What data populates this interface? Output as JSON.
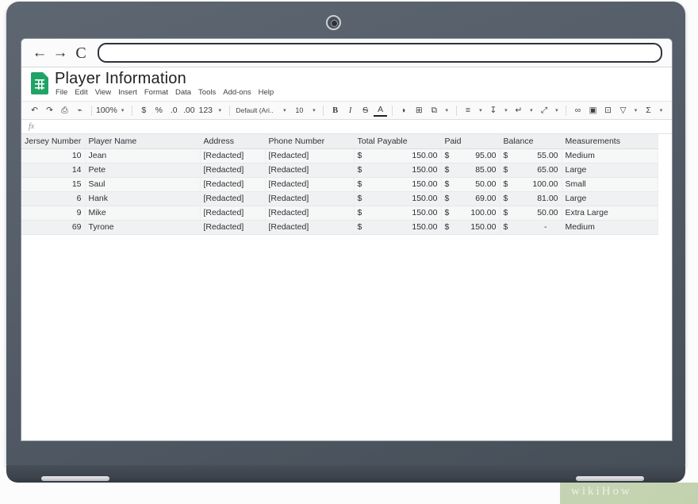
{
  "browser": {
    "back_icon": "back-arrow-icon",
    "forward_icon": "forward-arrow-icon",
    "reload_label": "C",
    "address_value": "",
    "address_placeholder": ""
  },
  "app": {
    "doc_title": "Player Information",
    "logo": "google-sheets-icon",
    "menus": [
      "File",
      "Edit",
      "View",
      "Insert",
      "Format",
      "Data",
      "Tools",
      "Add-ons",
      "Help"
    ]
  },
  "toolbar": {
    "undo": "↶",
    "redo": "↷",
    "print": "⎙",
    "paint_format": "⌁",
    "zoom_value": "100%",
    "currency": "$",
    "percent": "%",
    "decrease_decimal": ".0",
    "increase_decimal": ".00",
    "number_format": "123",
    "font_family": "Default (Ari..",
    "font_size": "10",
    "bold": "B",
    "italic": "I",
    "strikethrough": "S",
    "text_color": "A",
    "fill_color": "◗",
    "borders": "⊞",
    "merge_cells": "⧉",
    "align": "≡",
    "vertical_align": "↧",
    "text_wrap": "↵",
    "text_rotation": "⤢",
    "insert_link": "∞",
    "insert_comment": "▣",
    "insert_chart": "⊡",
    "filter": "▽",
    "functions": "Σ",
    "caret": "▾"
  },
  "formula_bar": {
    "fx_label": "fx",
    "value": ""
  },
  "sheet": {
    "columns": [
      "Jersey Number",
      "Player Name",
      "Address",
      "Phone Number",
      "Total Payable",
      "Paid",
      "Balance",
      "Measurements"
    ],
    "rows": [
      {
        "jersey": "10",
        "name": "Jean",
        "address": "[Redacted]",
        "phone": "[Redacted]",
        "total_sym": "$",
        "total_amt": "150.00",
        "paid_sym": "$",
        "paid_amt": "95.00",
        "balance_sym": "$",
        "balance_amt": "55.00",
        "measurements": "Medium"
      },
      {
        "jersey": "14",
        "name": "Pete",
        "address": "[Redacted]",
        "phone": "[Redacted]",
        "total_sym": "$",
        "total_amt": "150.00",
        "paid_sym": "$",
        "paid_amt": "85.00",
        "balance_sym": "$",
        "balance_amt": "65.00",
        "measurements": "Large"
      },
      {
        "jersey": "15",
        "name": "Saul",
        "address": "[Redacted]",
        "phone": "[Redacted]",
        "total_sym": "$",
        "total_amt": "150.00",
        "paid_sym": "$",
        "paid_amt": "50.00",
        "balance_sym": "$",
        "balance_amt": "100.00",
        "measurements": "Small"
      },
      {
        "jersey": "6",
        "name": "Hank",
        "address": "[Redacted]",
        "phone": "[Redacted]",
        "total_sym": "$",
        "total_amt": "150.00",
        "paid_sym": "$",
        "paid_amt": "69.00",
        "balance_sym": "$",
        "balance_amt": "81.00",
        "measurements": "Large"
      },
      {
        "jersey": "9",
        "name": "Mike",
        "address": "[Redacted]",
        "phone": "[Redacted]",
        "total_sym": "$",
        "total_amt": "150.00",
        "paid_sym": "$",
        "paid_amt": "100.00",
        "balance_sym": "$",
        "balance_amt": "50.00",
        "measurements": "Extra Large"
      },
      {
        "jersey": "69",
        "name": "Tyrone",
        "address": "[Redacted]",
        "phone": "[Redacted]",
        "total_sym": "$",
        "total_amt": "150.00",
        "paid_sym": "$",
        "paid_amt": "150.00",
        "balance_sym": "$",
        "balance_amt": "-",
        "measurements": "Medium"
      }
    ]
  },
  "watermark": {
    "text": "wikiHow"
  },
  "colors": {
    "laptop_bezel": "#5d6671",
    "sheets_green": "#21a366",
    "grid_row_light": "#f6f7f7",
    "grid_row_dark": "#f0f1f2",
    "header_gray": "#eeeff0"
  }
}
